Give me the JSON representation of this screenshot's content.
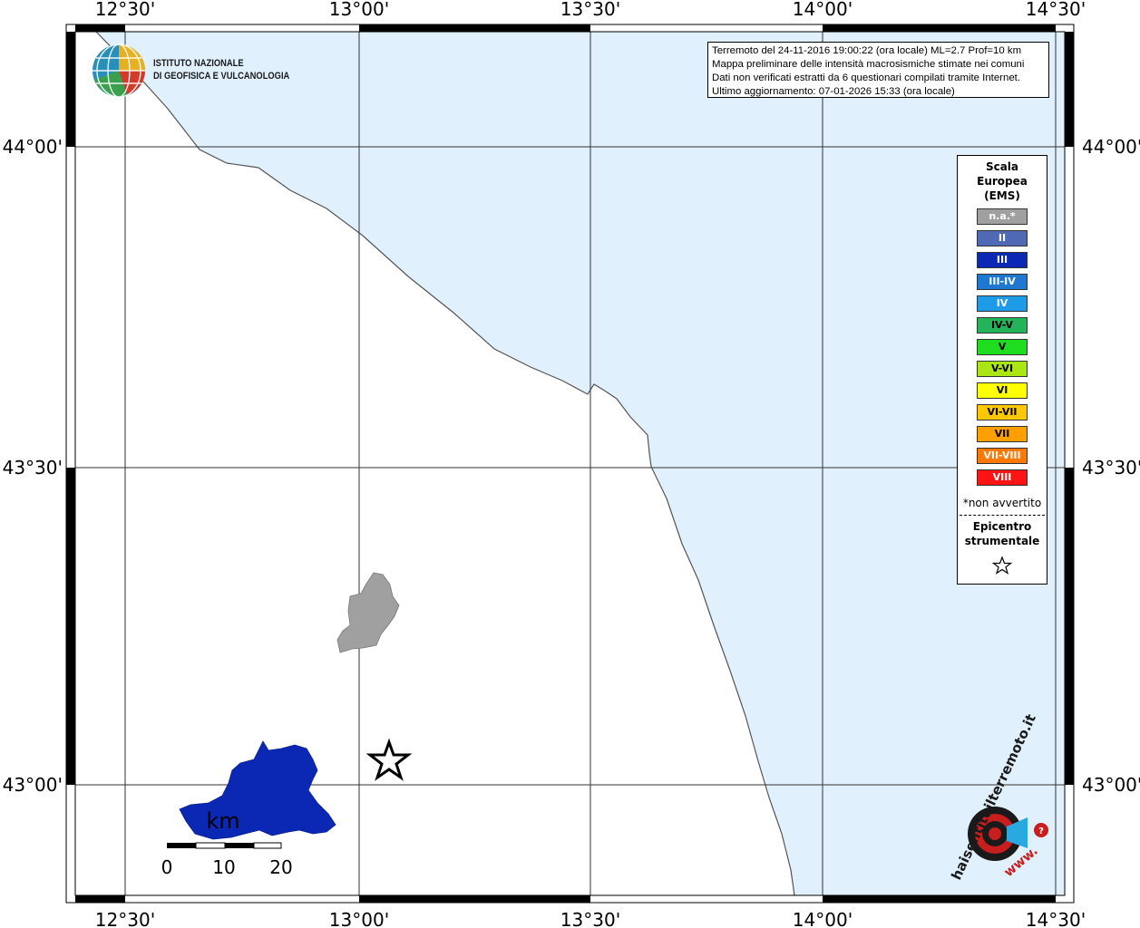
{
  "axes": {
    "lon_ticks_top": [
      "12°30'",
      "13°00'",
      "13°30'",
      "14°00'",
      "14°30'"
    ],
    "lon_ticks_bottom": [
      "12°30'",
      "13°00'",
      "13°30'",
      "14°00'",
      "14°30'"
    ],
    "lat_ticks_left": [
      "44°00'",
      "43°30'",
      "43°00'"
    ],
    "lat_ticks_right": [
      "44°00'",
      "43°30'",
      "43°00'"
    ]
  },
  "info": {
    "line1": "Terremoto del 24-11-2016 19:00:22 (ora locale) ML=2.7 Prof=10 km",
    "line2": "Mappa preliminare delle intensità macrosismiche stimate nei comuni",
    "line3": "Dati non verificati estratti da 6 questionari compilati tramite Internet.",
    "line4": "Ultimo aggiornamento: 07-01-2026 15:33 (ora locale)"
  },
  "logo": {
    "line1": "ISTITUTO NAZIONALE",
    "line2": "DI GEOFISICA E VULCANOLOGIA"
  },
  "legend": {
    "title1": "Scala",
    "title2": "Europea",
    "title3": "(EMS)",
    "items": [
      {
        "label": "n.a.*",
        "color": "#a0a0a0"
      },
      {
        "label": "II",
        "color": "#5069b4"
      },
      {
        "label": "III",
        "color": "#0a28b4"
      },
      {
        "label": "III-IV",
        "color": "#1e78d2"
      },
      {
        "label": "IV",
        "color": "#1e9be6"
      },
      {
        "label": "IV-V",
        "color": "#23b45a"
      },
      {
        "label": "V",
        "color": "#1edc1e"
      },
      {
        "label": "V-VI",
        "color": "#aae614"
      },
      {
        "label": "VI",
        "color": "#ffff00"
      },
      {
        "label": "VI-VII",
        "color": "#ffc800"
      },
      {
        "label": "VII",
        "color": "#ffa000"
      },
      {
        "label": "VII-VIII",
        "color": "#ff7800"
      },
      {
        "label": "VIII",
        "color": "#ff1414"
      }
    ],
    "note": "*non avvertito",
    "epicenter1": "Epicentro",
    "epicenter2": "strumentale"
  },
  "scalebar": {
    "unit": "km",
    "labels": [
      "0",
      "10",
      "20"
    ]
  },
  "watermark": {
    "text": "haisentitoilterremoto.it",
    "url": "www."
  },
  "colors": {
    "sea": "#e0f0fc",
    "intensity_na": "#a0a0a0",
    "intensity_iii": "#0a28b4"
  }
}
